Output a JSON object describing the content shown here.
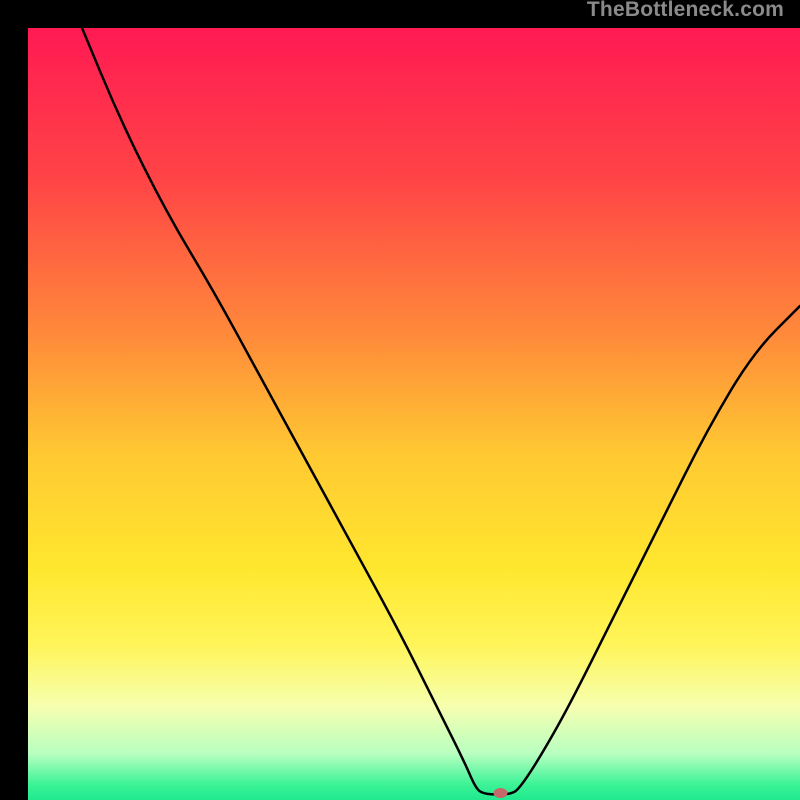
{
  "watermark": "TheBottleneck.com",
  "chart_data": {
    "type": "line",
    "title": "",
    "xlabel": "",
    "ylabel": "",
    "xlim": [
      0,
      100
    ],
    "ylim": [
      0,
      100
    ],
    "gradient_stops": [
      {
        "offset": 0.0,
        "color": "#ff1a53"
      },
      {
        "offset": 0.2,
        "color": "#ff4546"
      },
      {
        "offset": 0.4,
        "color": "#ff8b3a"
      },
      {
        "offset": 0.55,
        "color": "#ffc832"
      },
      {
        "offset": 0.7,
        "color": "#ffe72e"
      },
      {
        "offset": 0.8,
        "color": "#fff55a"
      },
      {
        "offset": 0.88,
        "color": "#f5ffb0"
      },
      {
        "offset": 0.94,
        "color": "#b8ffc0"
      },
      {
        "offset": 0.98,
        "color": "#3cf396"
      },
      {
        "offset": 1.0,
        "color": "#1fe98e"
      }
    ],
    "curve": [
      {
        "x": 7.0,
        "y": 100.0
      },
      {
        "x": 12.0,
        "y": 88.0
      },
      {
        "x": 18.0,
        "y": 76.0
      },
      {
        "x": 24.0,
        "y": 66.0
      },
      {
        "x": 30.0,
        "y": 55.0
      },
      {
        "x": 36.0,
        "y": 44.0
      },
      {
        "x": 42.0,
        "y": 33.0
      },
      {
        "x": 48.0,
        "y": 22.0
      },
      {
        "x": 53.0,
        "y": 12.0
      },
      {
        "x": 56.5,
        "y": 5.0
      },
      {
        "x": 58.0,
        "y": 1.5
      },
      {
        "x": 59.0,
        "y": 0.8
      },
      {
        "x": 61.0,
        "y": 0.7
      },
      {
        "x": 62.5,
        "y": 0.8
      },
      {
        "x": 63.5,
        "y": 1.3
      },
      {
        "x": 66.0,
        "y": 5.0
      },
      {
        "x": 70.0,
        "y": 12.0
      },
      {
        "x": 76.0,
        "y": 24.0
      },
      {
        "x": 82.0,
        "y": 36.0
      },
      {
        "x": 88.0,
        "y": 48.0
      },
      {
        "x": 94.0,
        "y": 58.0
      },
      {
        "x": 100.0,
        "y": 64.0
      }
    ],
    "marker": {
      "x": 61.2,
      "y": 0.9,
      "color": "#c46a6a",
      "rx": 7,
      "ry": 5
    }
  }
}
